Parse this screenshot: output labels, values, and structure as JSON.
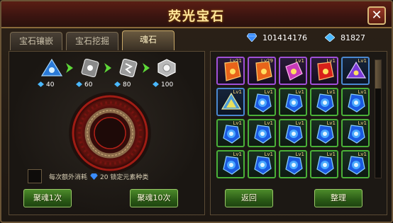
{
  "window": {
    "title": "荧光宝石"
  },
  "tabs": [
    {
      "label": "宝石镶嵌",
      "active": false
    },
    {
      "label": "宝石挖掘",
      "active": false
    },
    {
      "label": "魂石",
      "active": true
    }
  ],
  "currency": {
    "diamond": {
      "icon": "diamond-icon",
      "value": "101414176"
    },
    "crystal": {
      "icon": "crystal-icon",
      "value": "81827"
    }
  },
  "stages": [
    {
      "icon": "blue-soulstone-icon",
      "cost": "40"
    },
    {
      "icon": "silver-soulstone-icon",
      "cost": "60"
    },
    {
      "icon": "silver-rune-soulstone-icon",
      "cost": "80"
    },
    {
      "icon": "white-soulstone-icon",
      "cost": "100"
    }
  ],
  "options": {
    "note_prefix": "每次额外消耗",
    "note_amount": "20",
    "note_suffix": "锁定元素种类"
  },
  "buttons": {
    "gather_once": "聚魂1次",
    "gather_ten": "聚魂10次",
    "back": "返回",
    "sort": "整理"
  },
  "inventory": [
    {
      "level": "Lv21",
      "kind": "orange",
      "frame": "purple"
    },
    {
      "level": "Lv29",
      "kind": "orange",
      "frame": "purple"
    },
    {
      "level": "Lv1",
      "kind": "pink",
      "frame": "purple"
    },
    {
      "level": "Lv1",
      "kind": "red",
      "frame": "purple"
    },
    {
      "level": "Lv1",
      "kind": "violet",
      "frame": "blue"
    },
    {
      "level": "Lv1",
      "kind": "prism",
      "frame": "blue"
    },
    {
      "level": "Lv1",
      "kind": "blue",
      "frame": "green"
    },
    {
      "level": "Lv1",
      "kind": "blue",
      "frame": "green"
    },
    {
      "level": "Lv1",
      "kind": "blue",
      "frame": "green"
    },
    {
      "level": "Lv1",
      "kind": "blue",
      "frame": "green"
    },
    {
      "level": "Lv1",
      "kind": "blue",
      "frame": "green"
    },
    {
      "level": "Lv1",
      "kind": "blue",
      "frame": "green"
    },
    {
      "level": "Lv1",
      "kind": "blue",
      "frame": "green"
    },
    {
      "level": "Lv1",
      "kind": "blue",
      "frame": "green"
    },
    {
      "level": "Lv1",
      "kind": "blue",
      "frame": "green"
    },
    {
      "level": "Lv1",
      "kind": "blue",
      "frame": "green"
    },
    {
      "level": "Lv1",
      "kind": "blue",
      "frame": "green"
    },
    {
      "level": "Lv1",
      "kind": "blue",
      "frame": "green"
    },
    {
      "level": "Lv1",
      "kind": "blue",
      "frame": "green"
    },
    {
      "level": "Lv1",
      "kind": "blue",
      "frame": "green"
    }
  ],
  "colors": {
    "title": "#ffe69a",
    "button_green": "#4c8a2a",
    "frame_green": "#4ab038",
    "frame_purple": "#a050d8",
    "frame_blue": "#4a88d0"
  }
}
